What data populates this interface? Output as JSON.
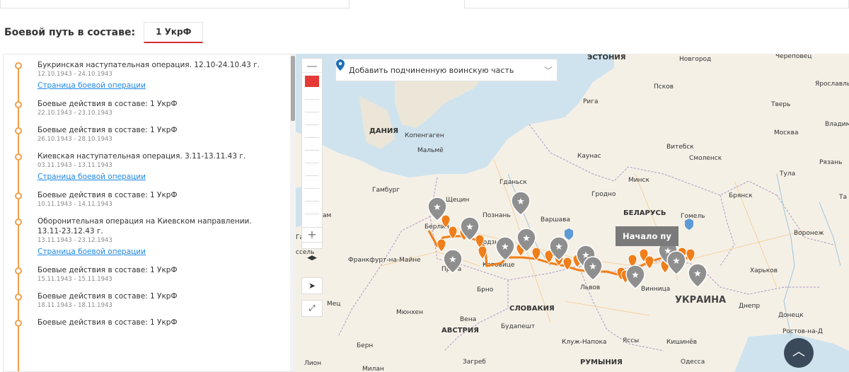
{
  "header": {
    "title": "Боевой путь в составе:",
    "tab_label": "1 УкрФ"
  },
  "list": [
    {
      "name": "Букринская наступательная операция. 12.10-24.10.43 г.",
      "dates": "12.10.1943 - 24.10.1943",
      "link": "Страница боевой операции"
    },
    {
      "name": "Боевые действия в составе: 1 УкрФ",
      "dates": "22.10.1943 - 23.10.1943",
      "link": ""
    },
    {
      "name": "Боевые действия в составе: 1 УкрФ",
      "dates": "26.10.1943 - 28.10.1943",
      "link": ""
    },
    {
      "name": "Киевская наступательная операция. 3.11-13.11.43 г.",
      "dates": "03.11.1943 - 13.11.1943",
      "link": "Страница боевой операции"
    },
    {
      "name": "Боевые действия в составе: 1 УкрФ",
      "dates": "10.11.1943 - 14.11.1943",
      "link": ""
    },
    {
      "name": "Оборонительная операция на Киевском направлении. 13.11-23.12.43 г.",
      "dates": "13.11.1943 - 23.12.1943",
      "link": "Страница боевой операции"
    },
    {
      "name": "Боевые действия в составе: 1 УкрФ",
      "dates": "15.11.1943 - 15.11.1943",
      "link": ""
    },
    {
      "name": "Боевые действия в составе: 1 УкрФ",
      "dates": "18.11.1943 - 18.11.1943",
      "link": ""
    },
    {
      "name": "Боевые действия в составе: 1 УкрФ",
      "dates": "",
      "link": ""
    }
  ],
  "map": {
    "unit_select": "Добавить подчиненную воинскую часть",
    "start_label": "Начало пу",
    "zoom_minus": "—",
    "zoom_plus": "+",
    "countries": [
      "ЭСТОНИЯ",
      "ДАНИЯ",
      "БЕЛАРУСЬ",
      "СЛОВАКИЯ",
      "АВСТРИЯ",
      "УКРАИНА",
      "РУМЫНИЯ"
    ],
    "cities": [
      "Новгород",
      "Череповец",
      "Псков",
      "Ярославль",
      "Рига",
      "Тверь",
      "Копенгаген",
      "Мальмё",
      "Москва",
      "Владим",
      "Витебск",
      "Смоленск",
      "Каунас",
      "Рязань",
      "Гданьск",
      "Минск",
      "Тула",
      "Гамбург",
      "Щецин",
      "Гродно",
      "Брянск",
      "Та",
      "Познань",
      "Варшава",
      "Гомель",
      "Берлин",
      "Воронеж",
      "Франкфурт-на-Майне",
      "Лодзь",
      "Катовице",
      "Прага",
      "Харьков",
      "Брно",
      "Львов",
      "Винница",
      "Днепр",
      "Мюнхен",
      "Вена",
      "Донецк",
      "Будапешт",
      "Ростов-на-Д",
      "Берн",
      "Клуж-Напока",
      "Яссы",
      "Кишинёв",
      "Лион",
      "Милан",
      "Загреб",
      "Одесса",
      "Мец",
      "ам",
      "Га",
      "ссель"
    ]
  },
  "colors": {
    "accent": "#d32f2f",
    "timeline": "#f1a04a",
    "link": "#1e88e5",
    "route": "#f07e1a",
    "pin_gray": "#8f8f8f"
  }
}
